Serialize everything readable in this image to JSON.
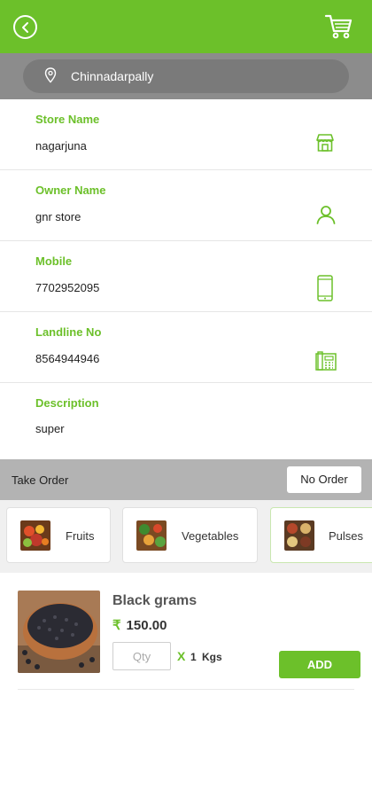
{
  "colors": {
    "accent": "#6cc02a",
    "bar_gray": "#8c8c8c",
    "order_bar": "#b3b3b3"
  },
  "header": {
    "back_icon": "chevron-left-circle-icon",
    "cart_icon": "shopping-cart-icon"
  },
  "location": {
    "icon": "map-pin-icon",
    "text": "Chinnadarpally"
  },
  "fields": [
    {
      "label": "Store Name",
      "value": "nagarjuna",
      "icon": "store-icon"
    },
    {
      "label": "Owner Name",
      "value": "gnr store",
      "icon": "user-icon"
    },
    {
      "label": "Mobile",
      "value": "7702952095",
      "icon": "mobile-phone-icon"
    },
    {
      "label": "Landline No",
      "value": "8564944946",
      "icon": "landline-phone-icon"
    },
    {
      "label": "Description",
      "value": "super"
    }
  ],
  "order_bar": {
    "take_order_label": "Take Order",
    "no_order_label": "No Order"
  },
  "categories": [
    {
      "label": "Fruits",
      "icon": "fruits-thumbnail"
    },
    {
      "label": "Vegetables",
      "icon": "vegetables-thumbnail"
    },
    {
      "label": "Pulses",
      "icon": "pulses-thumbnail",
      "selected": true
    }
  ],
  "product": {
    "name": "Black grams",
    "currency_symbol": "₹",
    "price": "150.00",
    "qty_placeholder": "Qty",
    "multiplier": "X",
    "quantity": "1",
    "unit": "Kgs",
    "add_label": "ADD"
  }
}
